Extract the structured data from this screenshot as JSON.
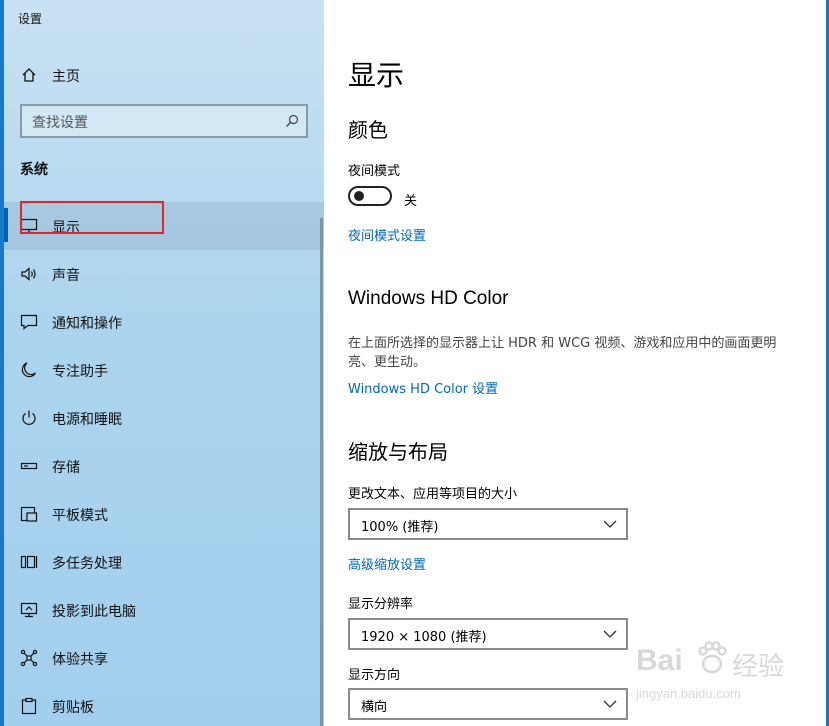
{
  "app": {
    "title": "设置"
  },
  "sidebar": {
    "home_label": "主页",
    "search_placeholder": "查找设置",
    "section_label": "系统",
    "items": [
      {
        "label": "显示",
        "icon": "monitor-icon",
        "active": true
      },
      {
        "label": "声音",
        "icon": "speaker-icon"
      },
      {
        "label": "通知和操作",
        "icon": "message-icon"
      },
      {
        "label": "专注助手",
        "icon": "moon-icon"
      },
      {
        "label": "电源和睡眠",
        "icon": "power-icon"
      },
      {
        "label": "存储",
        "icon": "storage-icon"
      },
      {
        "label": "平板模式",
        "icon": "tablet-icon"
      },
      {
        "label": "多任务处理",
        "icon": "multitask-icon"
      },
      {
        "label": "投影到此电脑",
        "icon": "project-icon"
      },
      {
        "label": "体验共享",
        "icon": "share-icon"
      },
      {
        "label": "剪贴板",
        "icon": "clipboard-icon"
      }
    ]
  },
  "main": {
    "page_title": "显示",
    "color_section": {
      "heading": "颜色",
      "night_mode_label": "夜间模式",
      "night_mode_state": "关",
      "night_mode_settings_link": "夜间模式设置"
    },
    "hd_color_section": {
      "heading": "Windows HD Color",
      "description": "在上面所选择的显示器上让 HDR 和 WCG 视频、游戏和应用中的画面更明亮、更生动。",
      "settings_link": "Windows HD Color 设置"
    },
    "scale_section": {
      "heading": "缩放与布局",
      "text_size_label": "更改文本、应用等项目的大小",
      "text_size_value": "100% (推荐)",
      "advanced_link": "高级缩放设置",
      "resolution_label": "显示分辨率",
      "resolution_value": "1920 × 1080 (推荐)",
      "orientation_label": "显示方向",
      "orientation_value": "横向"
    }
  },
  "watermark": {
    "brand_text": "Bai",
    "brand_text2": "经验",
    "url": "jingyan.baidu.com"
  },
  "colors": {
    "accent": "#0063b1",
    "link": "#0067c0",
    "highlight": "#e0262b",
    "sidebar": "#acd4ee"
  }
}
